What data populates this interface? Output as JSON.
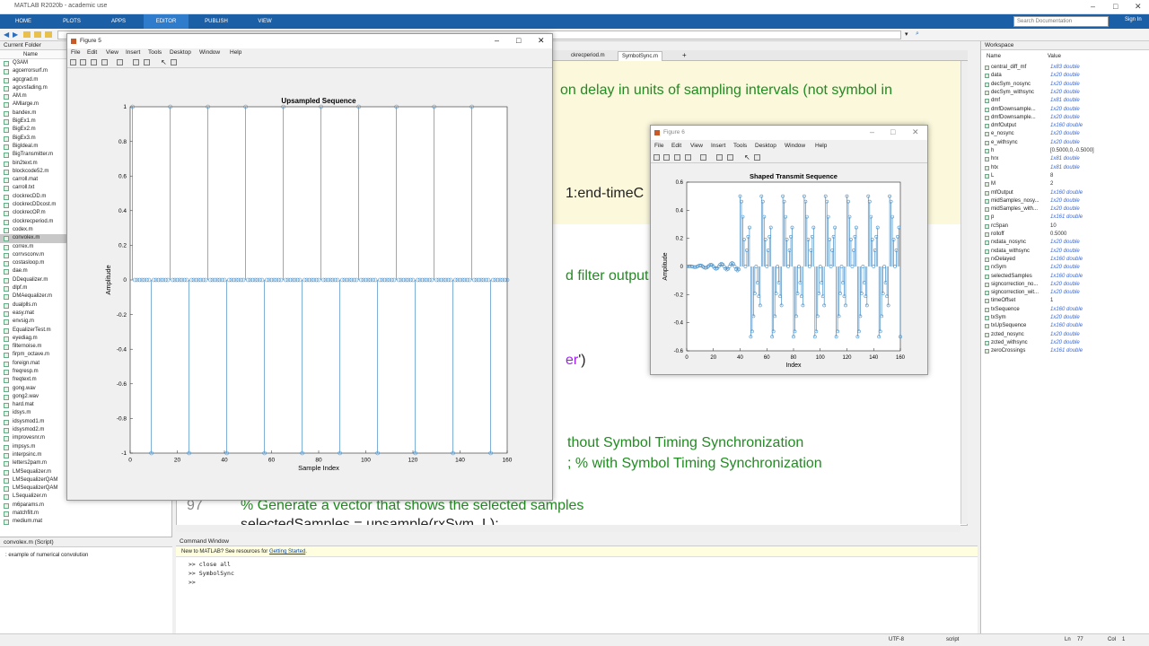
{
  "app": {
    "title": "MATLAB R2020b - academic use",
    "search_placeholder": "Search Documentation",
    "sign_in": "Sign In",
    "tabs": [
      "HOME",
      "PLOTS",
      "APPS",
      "EDITOR",
      "PUBLISH",
      "VIEW"
    ]
  },
  "current_folder": {
    "title": "Current Folder",
    "column": "Name",
    "files": [
      "Q3AM",
      "agcerrorsurf.m",
      "agcgrad.m",
      "agcvsfading.m",
      "AM.m",
      "AMlarge.m",
      "bandex.m",
      "BigEx1.m",
      "BigEx2.m",
      "BigEx3.m",
      "BigIdeal.m",
      "BigTransmitter.m",
      "bin2text.m",
      "blockcode52.m",
      "carroll.mat",
      "carroll.txt",
      "clockrecDD.m",
      "clockrecDDcost.m",
      "clockrecOP.m",
      "clockrecperiod.m",
      "codex.m",
      "convolex.m",
      "correx.m",
      "corrvsconv.m",
      "costasloop.m",
      "dae.m",
      "DDequalizer.m",
      "dlpf.m",
      "DMAequalizer.m",
      "dualplls.m",
      "easy.mat",
      "envsig.m",
      "EqualizerTest.m",
      "eyediag.m",
      "filternoise.m",
      "firpm_octave.m",
      "foreign.mat",
      "freqresp.m",
      "freqtext.m",
      "gong.wav",
      "gong2.wav",
      "hard.mat",
      "idsys.m",
      "idsysmod1.m",
      "idsysmod2.m",
      "improvesnr.m",
      "impsys.m",
      "interpsinc.m",
      "letters2pam.m",
      "LMSequalizer.m",
      "LMSequalizerQAM",
      "LMSequalizerQAM",
      "LSequalizer.m",
      "m6params.m",
      "matchfilt.m",
      "medium.mat"
    ],
    "selected": "convolex.m",
    "details_title": "convolex.m  (Script)",
    "details_text": ": example of numerical convolution"
  },
  "editor": {
    "tabs": [
      "ckrecperiod.m",
      "SymbolSync.m"
    ],
    "active_tab": "SymbolSync.m",
    "lines": {
      "l1": "on delay in units of sampling intervals (not symbol in",
      "l2": "1:end-timeC",
      "l3": "d filter output",
      "l4": "er",
      "l4b": "')",
      "l5": "thout Symbol Timing Synchronization",
      "l6": ";    % with Symbol Timing Synchronization",
      "ln97": "97",
      "l7": "% Generate a vector that shows the selected samples",
      "l8": "selectedSamples = upsample(rxSym, L);"
    }
  },
  "command_window": {
    "title": "Command Window",
    "banner": "New to MATLAB? See resources for",
    "banner_link": "Getting Started",
    "banner_end": ".",
    "lines": [
      ">> close all",
      ">> SymbolSync",
      ">>"
    ]
  },
  "workspace": {
    "title": "Workspace",
    "col_name": "Name",
    "col_value": "Value",
    "vars": [
      {
        "name": "central_diff_mf",
        "value": "1x83 double",
        "italic": true
      },
      {
        "name": "data",
        "value": "1x20 double",
        "italic": true
      },
      {
        "name": "decSym_nosync",
        "value": "1x20 double",
        "italic": true
      },
      {
        "name": "decSym_withsync",
        "value": "1x20 double",
        "italic": true
      },
      {
        "name": "dmf",
        "value": "1x81 double",
        "italic": true
      },
      {
        "name": "dmfDownsample...",
        "value": "1x20 double",
        "italic": true
      },
      {
        "name": "dmfDownsample...",
        "value": "1x20 double",
        "italic": true
      },
      {
        "name": "dmfOutput",
        "value": "1x160 double",
        "italic": true
      },
      {
        "name": "e_nosync",
        "value": "1x20 double",
        "italic": true
      },
      {
        "name": "e_withsync",
        "value": "1x20 double",
        "italic": true
      },
      {
        "name": "h",
        "value": "[0.5000,0,-0.5000]",
        "italic": false
      },
      {
        "name": "hrx",
        "value": "1x81 double",
        "italic": true
      },
      {
        "name": "htx",
        "value": "1x81 double",
        "italic": true
      },
      {
        "name": "L",
        "value": "8",
        "italic": false
      },
      {
        "name": "M",
        "value": "2",
        "italic": false
      },
      {
        "name": "mfOutput",
        "value": "1x160 double",
        "italic": true
      },
      {
        "name": "midSamples_nosy...",
        "value": "1x20 double",
        "italic": true
      },
      {
        "name": "midSamples_with...",
        "value": "1x20 double",
        "italic": true
      },
      {
        "name": "p",
        "value": "1x161 double",
        "italic": true
      },
      {
        "name": "rcSpan",
        "value": "10",
        "italic": false
      },
      {
        "name": "rolloff",
        "value": "0.5000",
        "italic": false
      },
      {
        "name": "rxdata_nosync",
        "value": "1x20 double",
        "italic": true
      },
      {
        "name": "rxdata_withsync",
        "value": "1x20 double",
        "italic": true
      },
      {
        "name": "rxDelayed",
        "value": "1x160 double",
        "italic": true
      },
      {
        "name": "rxSym",
        "value": "1x20 double",
        "italic": true
      },
      {
        "name": "selectedSamples",
        "value": "1x160 double",
        "italic": true
      },
      {
        "name": "signcorrection_no...",
        "value": "1x20 double",
        "italic": true
      },
      {
        "name": "signcorrection_wit...",
        "value": "1x20 double",
        "italic": true
      },
      {
        "name": "timeOffset",
        "value": "1",
        "italic": false
      },
      {
        "name": "txSequence",
        "value": "1x160 double",
        "italic": true
      },
      {
        "name": "txSym",
        "value": "1x20 double",
        "italic": true
      },
      {
        "name": "txUpSequence",
        "value": "1x160 double",
        "italic": true
      },
      {
        "name": "zcted_nosync",
        "value": "1x20 double",
        "italic": true
      },
      {
        "name": "zcted_withsync",
        "value": "1x20 double",
        "italic": true
      },
      {
        "name": "zeroCrossings",
        "value": "1x161 double",
        "italic": true
      }
    ]
  },
  "status": {
    "encoding": "UTF-8",
    "type": "script",
    "ln_label": "Ln",
    "ln": "77",
    "col_label": "Col",
    "col": "1"
  },
  "figure5": {
    "title": "Figure 5",
    "menus": [
      "File",
      "Edit",
      "View",
      "Insert",
      "Tools",
      "Desktop",
      "Window",
      "Help"
    ]
  },
  "figure6": {
    "title": "Figure 6",
    "menus": [
      "File",
      "Edit",
      "View",
      "Insert",
      "Tools",
      "Desktop",
      "Window",
      "Help"
    ]
  },
  "colors": {
    "ribbon": "#1b5fa6",
    "plot_line": "#4a90c8",
    "comment_green": "#228b22"
  },
  "chart_data": [
    {
      "type": "stem",
      "title": "Upsampled Sequence",
      "xlabel": "Sample Index",
      "ylabel": "Amplitude",
      "xlim": [
        0,
        160
      ],
      "ylim": [
        -1,
        1
      ],
      "xticks": [
        0,
        20,
        40,
        60,
        80,
        100,
        120,
        140,
        160
      ],
      "yticks": [
        -1,
        -0.8,
        -0.6,
        -0.4,
        -0.2,
        0,
        0.2,
        0.4,
        0.6,
        0.8,
        1
      ],
      "ytick_labels": [
        "-1",
        "-0.8",
        "-0.6",
        "-0.4",
        "-0.2",
        "0",
        "0.2",
        "0.4",
        "0.6",
        "0.8",
        "1"
      ],
      "upsample_factor": 8,
      "symbols": [
        1,
        -1,
        1,
        -1,
        1,
        -1,
        1,
        -1,
        1,
        -1,
        1,
        -1,
        1,
        -1,
        1,
        -1,
        1,
        -1,
        1,
        -1
      ]
    },
    {
      "type": "stem",
      "title": "Shaped Transmit Sequence",
      "xlabel": "Index",
      "ylabel": "Amplitude",
      "xlim": [
        0,
        160
      ],
      "ylim": [
        -0.6,
        0.6
      ],
      "xticks": [
        0,
        20,
        40,
        60,
        80,
        100,
        120,
        140,
        160
      ],
      "yticks": [
        -0.6,
        -0.4,
        -0.2,
        0,
        0.2,
        0.4,
        0.6
      ],
      "ytick_labels": [
        "-0.6",
        "-0.4",
        "-0.2",
        "0",
        "0.2",
        "0.4",
        "0.6"
      ],
      "start_index": 40,
      "symbol_spacing": 8,
      "peak": 0.5,
      "pre_ripple_amplitude": 0.03
    }
  ]
}
